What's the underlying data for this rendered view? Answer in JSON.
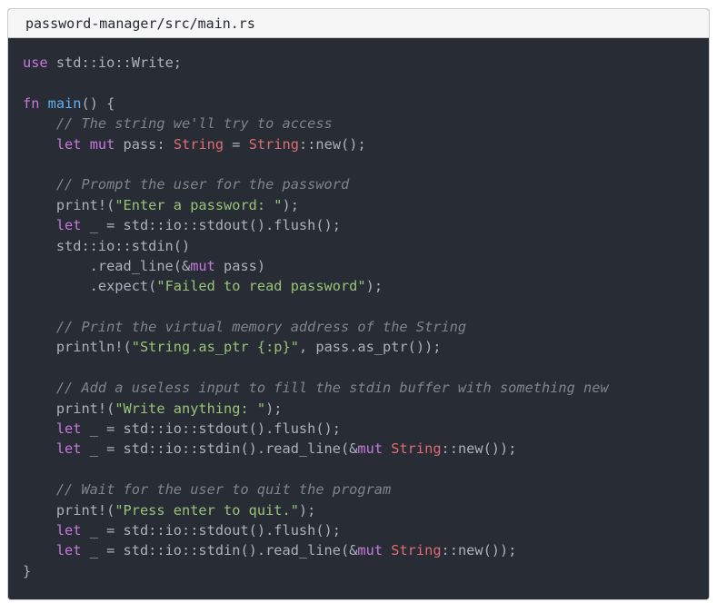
{
  "file": {
    "path": "password-manager/src/main.rs"
  },
  "colors": {
    "background": "#282c34",
    "keyword": "#c678dd",
    "function": "#61afef",
    "type": "#e06c75",
    "string": "#98c379",
    "comment": "#7f848e",
    "text": "#abb2bf"
  },
  "code": {
    "lines": [
      [
        [
          "kw",
          "use"
        ],
        [
          "plain",
          " std::io::Write;"
        ]
      ],
      [],
      [
        [
          "kw",
          "fn"
        ],
        [
          "plain",
          " "
        ],
        [
          "fn",
          "main"
        ],
        [
          "plain",
          "() {"
        ]
      ],
      [
        [
          "plain",
          "    "
        ],
        [
          "com",
          "// The string we'll try to access"
        ]
      ],
      [
        [
          "plain",
          "    "
        ],
        [
          "kw",
          "let"
        ],
        [
          "plain",
          " "
        ],
        [
          "kw",
          "mut"
        ],
        [
          "plain",
          " pass: "
        ],
        [
          "ty",
          "String"
        ],
        [
          "plain",
          " = "
        ],
        [
          "ty",
          "String"
        ],
        [
          "plain",
          "::new();"
        ]
      ],
      [],
      [
        [
          "plain",
          "    "
        ],
        [
          "com",
          "// Prompt the user for the password"
        ]
      ],
      [
        [
          "plain",
          "    print!("
        ],
        [
          "str",
          "\"Enter a password: \""
        ],
        [
          "plain",
          ");"
        ]
      ],
      [
        [
          "plain",
          "    "
        ],
        [
          "kw",
          "let"
        ],
        [
          "plain",
          " _ = std::io::stdout().flush();"
        ]
      ],
      [
        [
          "plain",
          "    std::io::stdin()"
        ]
      ],
      [
        [
          "plain",
          "        .read_line(&"
        ],
        [
          "kw",
          "mut"
        ],
        [
          "plain",
          " pass)"
        ]
      ],
      [
        [
          "plain",
          "        .expect("
        ],
        [
          "str",
          "\"Failed to read password\""
        ],
        [
          "plain",
          ");"
        ]
      ],
      [],
      [
        [
          "plain",
          "    "
        ],
        [
          "com",
          "// Print the virtual memory address of the String"
        ]
      ],
      [
        [
          "plain",
          "    println!("
        ],
        [
          "str",
          "\"String.as_ptr {:p}\""
        ],
        [
          "plain",
          ", pass.as_ptr());"
        ]
      ],
      [],
      [
        [
          "plain",
          "    "
        ],
        [
          "com",
          "// Add a useless input to fill the stdin buffer with something new"
        ]
      ],
      [
        [
          "plain",
          "    print!("
        ],
        [
          "str",
          "\"Write anything: \""
        ],
        [
          "plain",
          ");"
        ]
      ],
      [
        [
          "plain",
          "    "
        ],
        [
          "kw",
          "let"
        ],
        [
          "plain",
          " _ = std::io::stdout().flush();"
        ]
      ],
      [
        [
          "plain",
          "    "
        ],
        [
          "kw",
          "let"
        ],
        [
          "plain",
          " _ = std::io::stdin().read_line(&"
        ],
        [
          "kw",
          "mut"
        ],
        [
          "plain",
          " "
        ],
        [
          "ty",
          "String"
        ],
        [
          "plain",
          "::new());"
        ]
      ],
      [],
      [
        [
          "plain",
          "    "
        ],
        [
          "com",
          "// Wait for the user to quit the program"
        ]
      ],
      [
        [
          "plain",
          "    print!("
        ],
        [
          "str",
          "\"Press enter to quit.\""
        ],
        [
          "plain",
          ");"
        ]
      ],
      [
        [
          "plain",
          "    "
        ],
        [
          "kw",
          "let"
        ],
        [
          "plain",
          " _ = std::io::stdout().flush();"
        ]
      ],
      [
        [
          "plain",
          "    "
        ],
        [
          "kw",
          "let"
        ],
        [
          "plain",
          " _ = std::io::stdin().read_line(&"
        ],
        [
          "kw",
          "mut"
        ],
        [
          "plain",
          " "
        ],
        [
          "ty",
          "String"
        ],
        [
          "plain",
          "::new());"
        ]
      ],
      [
        [
          "plain",
          "}"
        ]
      ]
    ]
  }
}
